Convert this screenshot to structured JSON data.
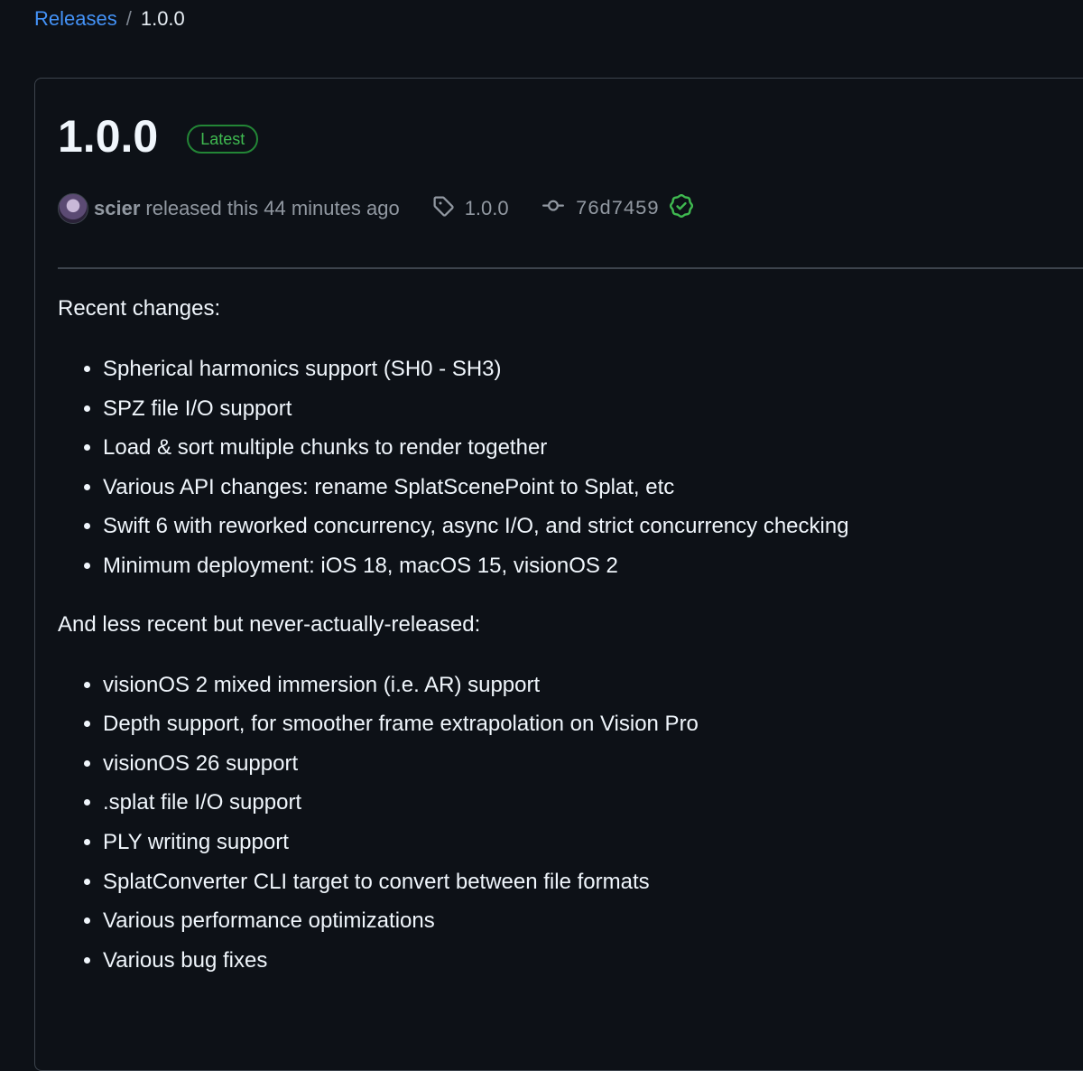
{
  "breadcrumb": {
    "releases_label": "Releases",
    "separator": "/",
    "current": "1.0.0"
  },
  "release": {
    "title": "1.0.0",
    "badge": "Latest",
    "author": "scier",
    "released_text": "released this 44 minutes ago",
    "tag": "1.0.0",
    "commit": "76d7459",
    "icons": {
      "tag": "tag-icon",
      "commit": "git-commit-icon",
      "verified": "verified-check-icon"
    },
    "colors": {
      "badge_green": "#3fb950",
      "link_blue": "#4493f8"
    }
  },
  "notes": {
    "section1_heading": "Recent changes:",
    "section1_items": [
      "Spherical harmonics support (SH0 - SH3)",
      "SPZ file I/O support",
      "Load & sort multiple chunks to render together",
      "Various API changes: rename SplatScenePoint to Splat, etc",
      "Swift 6 with reworked concurrency, async I/O, and strict concurrency checking",
      "Minimum deployment: iOS 18, macOS 15, visionOS 2"
    ],
    "section2_heading": "And less recent but never-actually-released:",
    "section2_items": [
      "visionOS 2 mixed immersion (i.e. AR) support",
      "Depth support, for smoother frame extrapolation on Vision Pro",
      "visionOS 26 support",
      ".splat file I/O support",
      "PLY writing support",
      "SplatConverter CLI target to convert between file formats",
      "Various performance optimizations",
      "Various bug fixes"
    ]
  }
}
